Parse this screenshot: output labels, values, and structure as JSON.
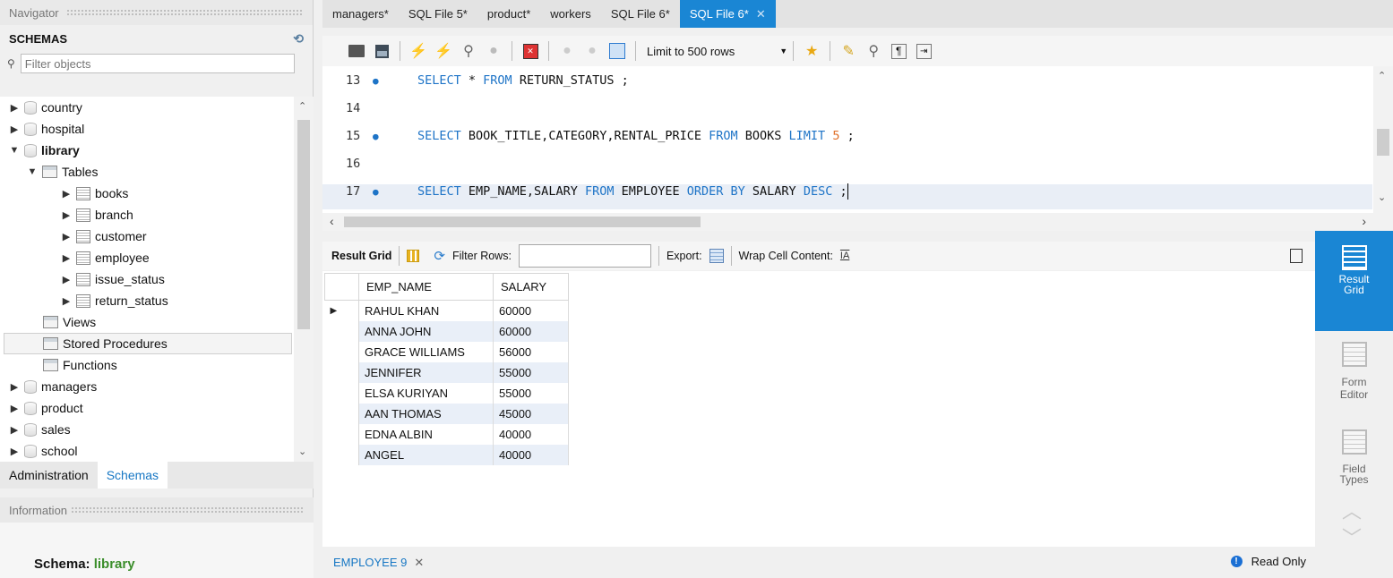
{
  "navigator": {
    "title": "Navigator",
    "schemas_label": "SCHEMAS",
    "filter_placeholder": "Filter objects",
    "tree": [
      {
        "label": "country",
        "kind": "schema",
        "expanded": false
      },
      {
        "label": "hospital",
        "kind": "schema",
        "expanded": false
      },
      {
        "label": "library",
        "kind": "schema",
        "expanded": true,
        "bold": true
      },
      {
        "label": "Tables",
        "kind": "folder",
        "expanded": true
      },
      {
        "label": "books",
        "kind": "table"
      },
      {
        "label": "branch",
        "kind": "table"
      },
      {
        "label": "customer",
        "kind": "table"
      },
      {
        "label": "employee",
        "kind": "table"
      },
      {
        "label": "issue_status",
        "kind": "table"
      },
      {
        "label": "return_status",
        "kind": "table"
      },
      {
        "label": "Views",
        "kind": "folder"
      },
      {
        "label": "Stored Procedures",
        "kind": "folder",
        "selected": true
      },
      {
        "label": "Functions",
        "kind": "folder"
      },
      {
        "label": "managers",
        "kind": "schema",
        "expanded": false
      },
      {
        "label": "product",
        "kind": "schema",
        "expanded": false
      },
      {
        "label": "sales",
        "kind": "schema",
        "expanded": false
      },
      {
        "label": "school",
        "kind": "schema",
        "expanded": false
      }
    ],
    "tabs": [
      {
        "label": "Administration",
        "active": false
      },
      {
        "label": "Schemas",
        "active": true
      }
    ],
    "info_title": "Information",
    "schema_info_label": "Schema:",
    "schema_info_value": "library"
  },
  "editor_tabs": [
    {
      "label": "managers*",
      "active": false
    },
    {
      "label": "SQL File 5*",
      "active": false
    },
    {
      "label": "product*",
      "active": false
    },
    {
      "label": "workers",
      "active": false
    },
    {
      "label": "SQL File 6*",
      "active": false
    },
    {
      "label": "SQL File 6*",
      "active": true
    }
  ],
  "toolbar": {
    "limit_label": "Limit to 500 rows"
  },
  "editor": {
    "lines": [
      {
        "num": "13",
        "dot": true,
        "parts": [
          [
            "kw",
            "SELECT"
          ],
          [
            "t",
            " * "
          ],
          [
            "kw",
            "FROM"
          ],
          [
            "t",
            " RETURN_STATUS ;"
          ]
        ]
      },
      {
        "num": "14",
        "dot": false,
        "parts": []
      },
      {
        "num": "15",
        "dot": true,
        "parts": [
          [
            "kw",
            "SELECT"
          ],
          [
            "t",
            " BOOK_TITLE,CATEGORY,RENTAL_PRICE "
          ],
          [
            "kw",
            "FROM"
          ],
          [
            "t",
            " BOOKS "
          ],
          [
            "kw",
            "LIMIT"
          ],
          [
            "t",
            " "
          ],
          [
            "num",
            "5"
          ],
          [
            "t",
            " ;"
          ]
        ]
      },
      {
        "num": "16",
        "dot": false,
        "parts": []
      },
      {
        "num": "17",
        "dot": true,
        "parts": [
          [
            "kw",
            "SELECT"
          ],
          [
            "t",
            " EMP_NAME,SALARY "
          ],
          [
            "kw",
            "FROM"
          ],
          [
            "t",
            " EMPLOYEE "
          ],
          [
            "kw",
            "ORDER BY"
          ],
          [
            "t",
            " SALARY "
          ],
          [
            "kw",
            "DESC"
          ],
          [
            "t",
            " ;"
          ]
        ]
      }
    ]
  },
  "result_toolbar": {
    "result_grid_label": "Result Grid",
    "filter_rows_label": "Filter Rows:",
    "export_label": "Export:",
    "wrap_label": "Wrap Cell Content:"
  },
  "result_grid": {
    "columns": [
      "EMP_NAME",
      "SALARY"
    ],
    "rows": [
      [
        "RAHUL KHAN",
        "60000"
      ],
      [
        "ANNA JOHN",
        "60000"
      ],
      [
        "GRACE WILLIAMS",
        "56000"
      ],
      [
        "JENNIFER",
        "55000"
      ],
      [
        "ELSA KURIYAN",
        "55000"
      ],
      [
        "AAN THOMAS",
        "45000"
      ],
      [
        "EDNA ALBIN",
        "40000"
      ],
      [
        "ANGEL",
        "40000"
      ]
    ]
  },
  "bottom": {
    "result_tab_label": "EMPLOYEE 9",
    "read_only_label": "Read Only"
  },
  "side_panel": {
    "result_grid_label": "Result Grid",
    "form_editor_label": "Form Editor",
    "field_types_label": "Field Types"
  },
  "colors": {
    "accent": "#1a86d4",
    "keyword": "#1e74c7",
    "number": "#e0702a",
    "schema_green": "#3b8e2b"
  }
}
